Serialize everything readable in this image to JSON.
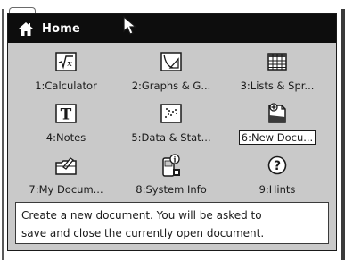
{
  "dialog": {
    "title": "Home",
    "title_icon": "home-icon"
  },
  "menu": {
    "selected_index": 5,
    "items": [
      {
        "label": "1:Calculator",
        "icon": "calculator-sqrt-icon"
      },
      {
        "label": "2:Graphs & G...",
        "icon": "graphs-geometry-icon"
      },
      {
        "label": "3:Lists & Spr...",
        "icon": "spreadsheet-icon"
      },
      {
        "label": "4:Notes",
        "icon": "notes-T-icon"
      },
      {
        "label": "5:Data & Stat...",
        "icon": "data-stats-icon"
      },
      {
        "label": "6:New Docu...",
        "icon": "new-document-icon"
      },
      {
        "label": "7:My Docum...",
        "icon": "my-documents-folder-icon"
      },
      {
        "label": "8:System Info",
        "icon": "system-info-icon"
      },
      {
        "label": "9:Hints",
        "icon": "hints-question-icon"
      }
    ]
  },
  "hint": {
    "line1": "Create a new document.  You will be asked to",
    "line2": "save and close the currently open document."
  }
}
